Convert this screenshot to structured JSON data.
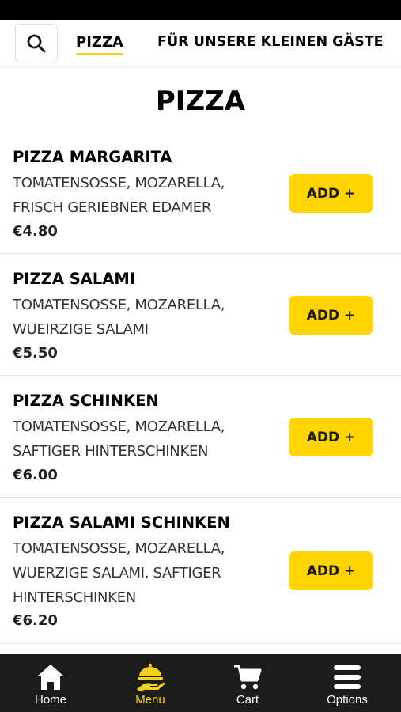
{
  "categories": {
    "active": "PIZZA",
    "kids": "FÜR UNSERE KLEINEN GÄSTE"
  },
  "section_title": "PIZZA",
  "items": [
    {
      "name": "PIZZA MARGARITA",
      "desc": [
        "TOMATENSOSSE, MOZARELLA,",
        "FRISCH GERIEBNER EDAMER"
      ],
      "price": "€4.80",
      "add_label": "ADD +"
    },
    {
      "name": "PIZZA SALAMI",
      "desc": [
        "TOMATENSOSSE, MOZARELLA,",
        "WUEIRZIGE SALAMI"
      ],
      "price": "€5.50",
      "add_label": "ADD +"
    },
    {
      "name": "PIZZA SCHINKEN",
      "desc": [
        "TOMATENSOSSE, MOZARELLA,",
        "SAFTIGER HINTERSCHINKEN"
      ],
      "price": "€6.00",
      "add_label": "ADD +"
    },
    {
      "name": "PIZZA SALAMI SCHINKEN",
      "desc": [
        "TOMATENSOSSE, MOZARELLA,",
        "WUERZIGE SALAMI, SAFTIGER",
        "HINTERSCHINKEN"
      ],
      "price": "€6.20",
      "add_label": "ADD +"
    }
  ],
  "bottom_nav": {
    "home": "Home",
    "menu": "Menu",
    "cart": "Cart",
    "options": "Options"
  },
  "colors": {
    "accent": "#ffd400",
    "nav_background": "#1c1c1c",
    "active_label": "#f5d21a"
  },
  "icons": {
    "search": "search-icon",
    "home": "home-icon",
    "menu": "serving-hand-icon",
    "cart": "cart-icon",
    "options": "hamburger-icon"
  }
}
